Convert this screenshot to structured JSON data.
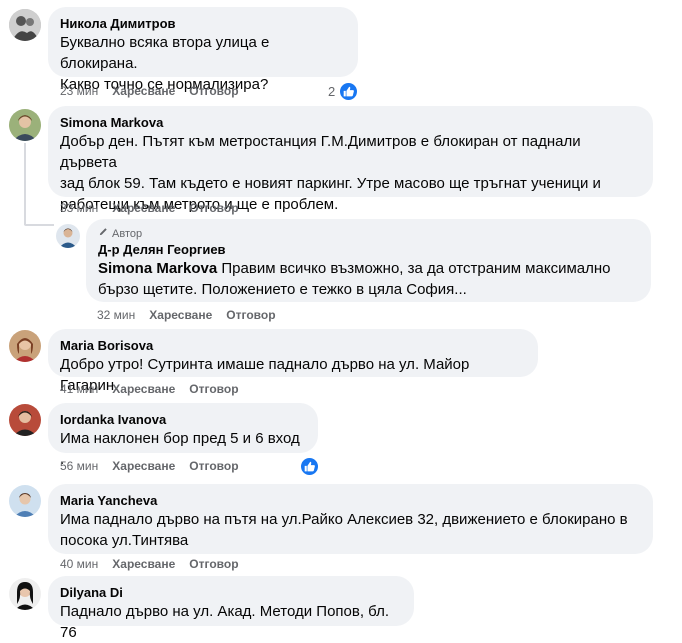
{
  "comments": [
    {
      "author": "Никола Димитров",
      "lines": [
        "Буквално всяка втора улица е блокирана.",
        "Какво точно се нормализира?"
      ],
      "time": "23 мин",
      "like_label": "Харесване",
      "reply_label": "Отговор",
      "reaction_count": "2"
    },
    {
      "author": "Simona Markova",
      "lines": [
        "Добър ден. Пътят към метростанция Г.М.Димитров е блокиран от паднали дървета",
        "зад блок 59. Там където е новият паркинг. Утре масово ще тръгнат ученици и",
        "работещи към метрото и ще е проблем."
      ],
      "time": "33 мин",
      "like_label": "Харесване",
      "reply_label": "Отговор"
    },
    {
      "author_badge": "Автор",
      "author": "Д-р Делян Георгиев",
      "mention": "Simona Markova",
      "lines": [
        "Правим всичко възможно, за да отстраним максимално",
        "бързо щетите. Положението е тежко в цяла София..."
      ],
      "time": "32 мин",
      "like_label": "Харесване",
      "reply_label": "Отговор"
    },
    {
      "author": "Maria Borisova",
      "lines": [
        "Добро утро! Сутринта имаше паднало дърво на ул. Майор Гагарин."
      ],
      "time": "41 мин",
      "like_label": "Харесване",
      "reply_label": "Отговор"
    },
    {
      "author": "Iordanka Ivanova",
      "lines": [
        "Има наклонен бор пред 5 и 6 вход ."
      ],
      "time": "56 мин",
      "like_label": "Харесване",
      "reply_label": "Отговор"
    },
    {
      "author": "Maria Yancheva",
      "lines": [
        "Има паднало дърво на пътя на ул.Райко Алексиев 32, движението е блокирано в",
        "посока ул.Тинтява"
      ],
      "time": "40 мин",
      "like_label": "Харесване",
      "reply_label": "Отговор"
    },
    {
      "author": "Dilyana Di",
      "lines": [
        "Паднало дърво на ул. Акад. Методи Попов, бл. 76"
      ]
    }
  ],
  "colors": {
    "bubble": "#f0f2f5",
    "meta": "#65676b",
    "like_blue": "#1877f2"
  }
}
